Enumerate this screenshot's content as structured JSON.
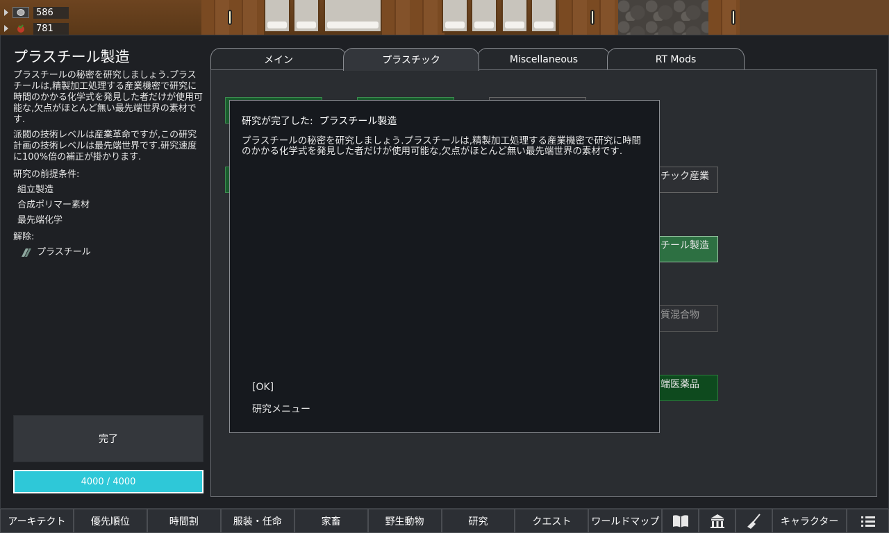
{
  "resources": [
    {
      "icon": "silver-icon",
      "amount": "586"
    },
    {
      "icon": "food-icon",
      "amount": "781"
    }
  ],
  "project": {
    "title": "プラスチール製造",
    "description": "プラスチールの秘密を研究しましょう.プラスチールは,精製加工処理する産業機密で研究に時間のかかる化学式を発見した者だけが使用可能な,欠点がほとんど無い最先端世界の素材です.",
    "tech_note": "派閥の技術レベルは産業革命ですが,この研究計画の技術レベルは最先端世界です.研究速度に100%倍の補正が掛かります.",
    "prereq_label": "研究の前提条件:",
    "prerequisites": [
      "組立製造",
      "合成ポリマー素材",
      "最先端化学"
    ],
    "unlock_label": "解除:",
    "unlocks": [
      "プラスチール"
    ],
    "done_button": "完了",
    "progress_text": "4000 / 4000",
    "progress_fraction": 1.0
  },
  "tabs": [
    "メイン",
    "プラスチック",
    "Miscellaneous",
    "RT Mods"
  ],
  "active_tab": 1,
  "nodes": [
    "チック産業",
    "チール製造",
    "質混合物",
    "端医薬品"
  ],
  "dialog": {
    "title": "研究が完了した:  プラスチール製造",
    "body": "プラスチールの秘密を研究しましょう.プラスチールは,精製加工処理する産業機密で研究に時間のかかる化学式を発見した者だけが使用可能な,欠点がほとんど無い最先端世界の素材です.",
    "ok": "[OK]",
    "research_menu": "研究メニュー"
  },
  "bottombar": {
    "architect": "アーキテクト",
    "priority": "優先順位",
    "schedule": "時間割",
    "assign": "服装・任命",
    "animals": "家畜",
    "wildlife": "野生動物",
    "research": "研究",
    "quests": "クエスト",
    "world_map": "ワールドマップ",
    "characters": "キャラクター"
  },
  "colors": {
    "progress": "#2ec8d8",
    "completed_node": "#1a5c2e",
    "panel": "#1e2024"
  }
}
